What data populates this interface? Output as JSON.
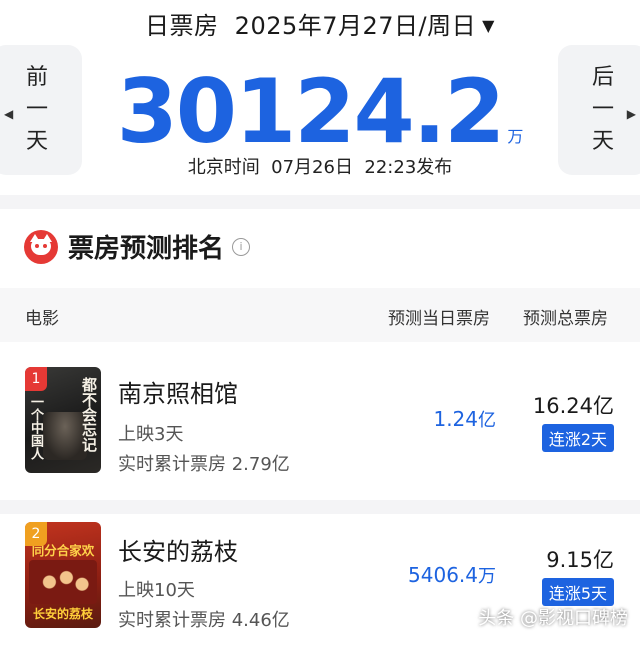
{
  "header": {
    "title": "日票房",
    "date": "2025年7月27日/周日",
    "dropdown_icon": "▼",
    "prev_day": [
      "前",
      "一",
      "天"
    ],
    "next_day": [
      "后",
      "一",
      "天"
    ],
    "total": "30124.2",
    "total_unit": "万",
    "publish_time": "北京时间  07月26日  22:23发布"
  },
  "section": {
    "title": "票房预测排名",
    "info_icon": "i"
  },
  "table": {
    "col_movie": "电影",
    "col_today": "预测当日票房",
    "col_total": "预测总票房"
  },
  "movies": [
    {
      "rank": "1",
      "name": "南京照相馆",
      "days": "上映3天",
      "cumulative": "实时累计票房 2.79亿",
      "today_value": "1.24",
      "today_unit": "亿",
      "total": "16.24亿",
      "streak": "连涨2天",
      "poster": {
        "vertical_a": "都不会忘记",
        "vertical_b": "一个中国人"
      }
    },
    {
      "rank": "2",
      "name": "长安的荔枝",
      "days": "上映10天",
      "cumulative": "实时累计票房 4.46亿",
      "today_value": "5406.4",
      "today_unit": "万",
      "total": "9.15亿",
      "streak": "连涨5天",
      "poster": {
        "top_text": "同分合家欢",
        "bottom_text": "长安的荔枝"
      }
    }
  ],
  "watermark": "头条 @影视口碑榜",
  "colors": {
    "accent": "#1d63e0",
    "brand_red": "#e53935"
  }
}
